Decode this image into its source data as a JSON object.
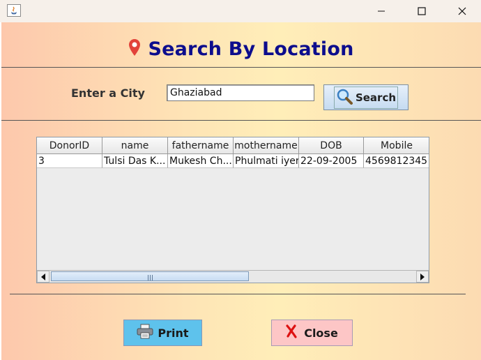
{
  "window": {
    "minimize_glyph": "—",
    "maximize_glyph": "☐",
    "close_glyph": "✕"
  },
  "header": {
    "title": "Search By Location",
    "icon": "location-pin-icon",
    "icon_color": "#e2423a",
    "title_color": "#0c0d8d"
  },
  "form": {
    "city_label": "Enter a City",
    "city_value": "Ghaziabad",
    "search_label": "Search",
    "search_icon": "magnifier-icon"
  },
  "table": {
    "columns": [
      "DonorID",
      "name",
      "fathername",
      "mothername",
      "DOB",
      "Mobile"
    ],
    "rows": [
      [
        "3",
        "Tulsi  Das K...",
        "Mukesh Ch...",
        "Phulmati iyer",
        "22-09-2005",
        "4569812345"
      ]
    ]
  },
  "actions": {
    "print_label": "Print",
    "print_icon": "printer-icon",
    "print_color": "#5ec2ec",
    "close_label": "Close",
    "close_icon": "red-x-icon",
    "close_color": "#fdc6c6"
  }
}
